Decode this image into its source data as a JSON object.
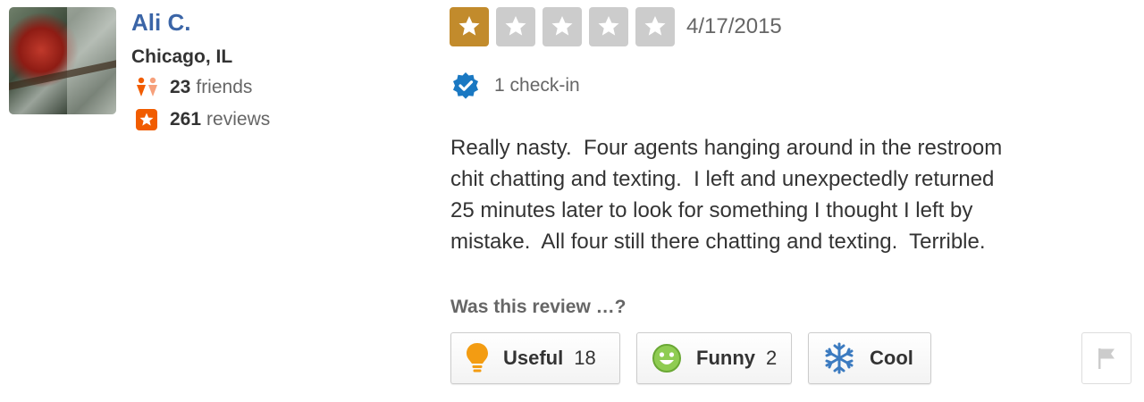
{
  "user": {
    "name": "Ali C.",
    "location": "Chicago, IL",
    "friends_count": "23",
    "friends_label": "friends",
    "reviews_count": "261",
    "reviews_label": "reviews"
  },
  "review": {
    "rating": 1,
    "max_rating": 5,
    "date": "4/17/2015",
    "checkin": "1 check-in",
    "text": "Really nasty.  Four agents hanging around in the restroom\nchit chatting and texting.  I left and unexpectedly returned\n25 minutes later to look for something I thought I left by\nmistake.  All four still there chatting and texting.  Terrible."
  },
  "votes": {
    "question": "Was this review …?",
    "useful_label": "Useful",
    "useful_count": "18",
    "funny_label": "Funny",
    "funny_count": "2",
    "cool_label": "Cool"
  },
  "icons": {
    "friends": "friends-icon",
    "reviews": "review-star-icon",
    "checkin": "verified-checkin-icon",
    "useful": "lightbulb-icon",
    "funny": "smiley-icon",
    "cool": "snowflake-icon",
    "flag": "flag-icon"
  },
  "colors": {
    "user_name": "#3b65a7",
    "star_filled": "#c28b2c",
    "star_empty": "#cccccc",
    "review_badge": "#f15c00",
    "checkin_badge": "#1a78c2"
  }
}
